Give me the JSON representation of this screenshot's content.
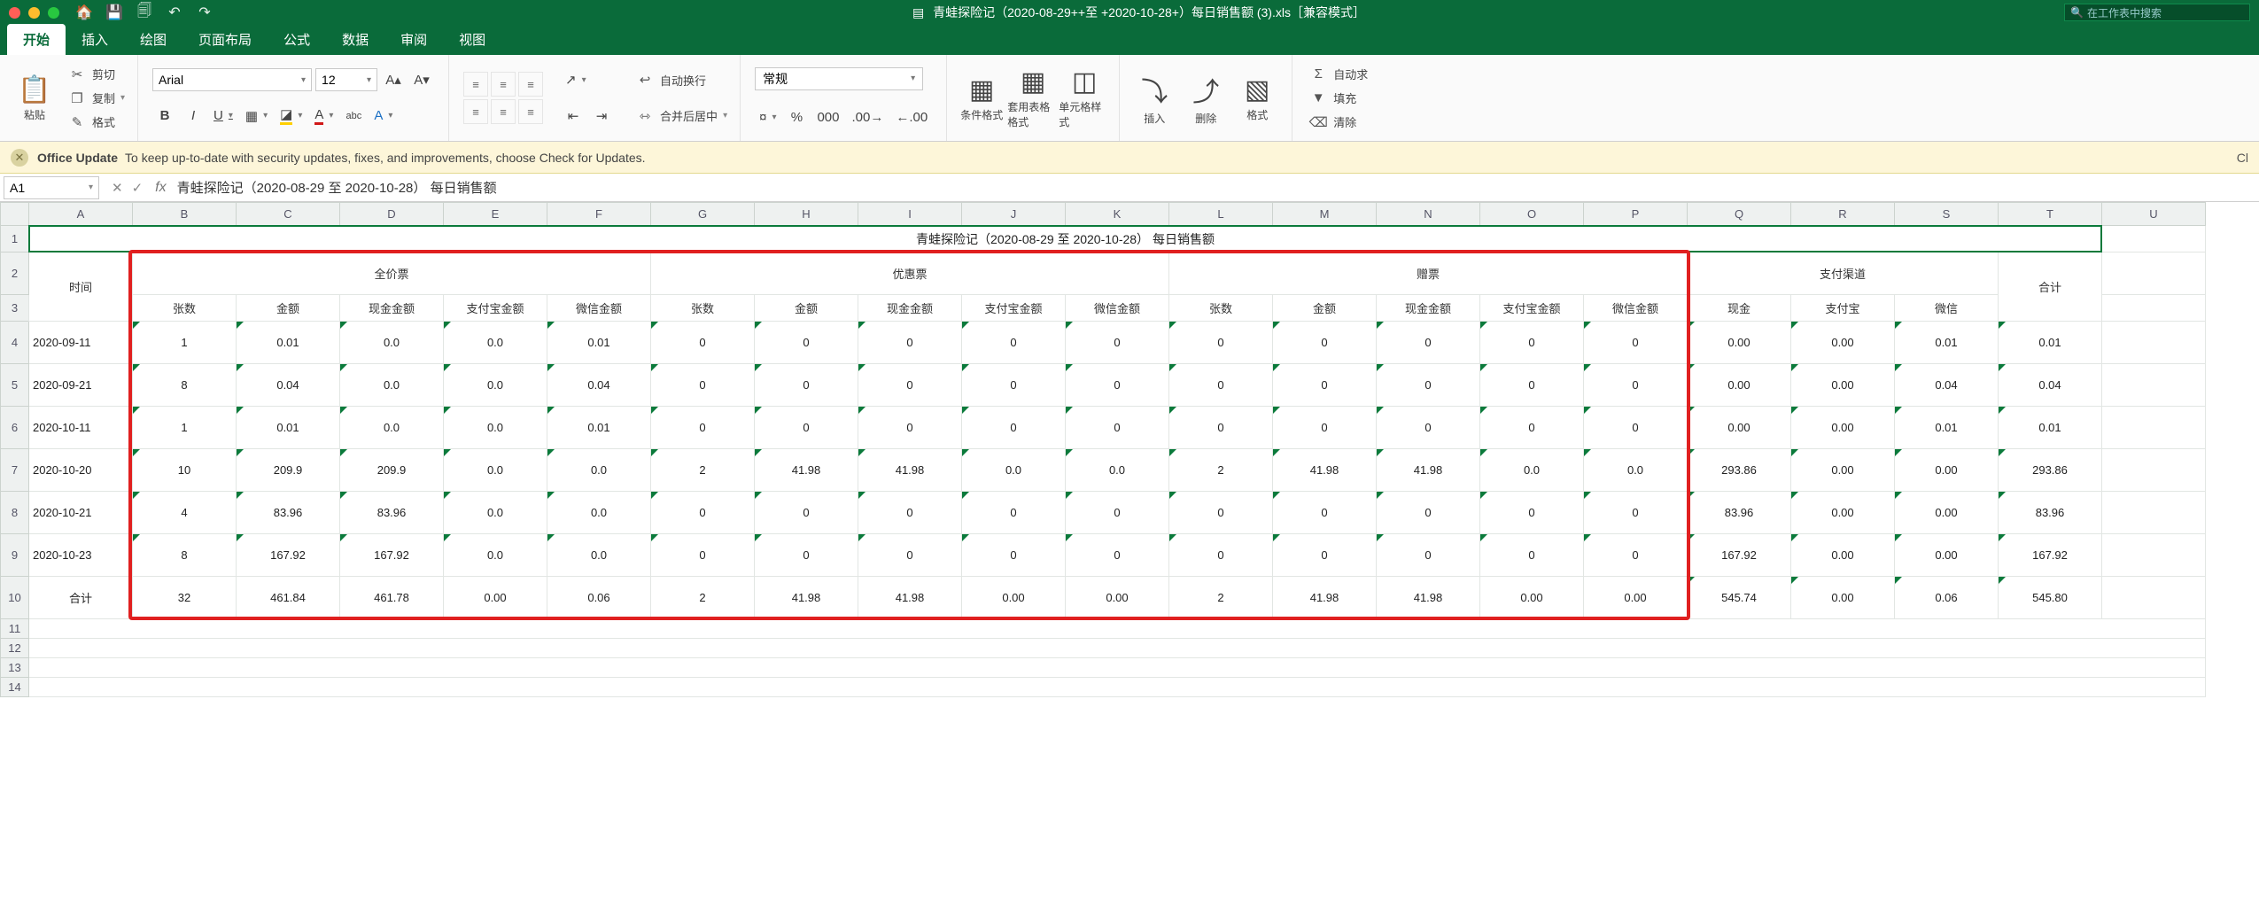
{
  "app": {
    "title": "青蛙探险记（2020-08-29++至 +2020-10-28+）每日销售额 (3).xls［兼容模式］",
    "search_placeholder": "在工作表中搜索"
  },
  "tabs": [
    "开始",
    "插入",
    "绘图",
    "页面布局",
    "公式",
    "数据",
    "审阅",
    "视图"
  ],
  "tabs_active_index": 0,
  "ribbon": {
    "clipboard": {
      "paste": "粘贴",
      "cut": "剪切",
      "copy": "复制",
      "format": "格式"
    },
    "font_name": "Arial",
    "font_size": "12",
    "btn_bold": "B",
    "btn_italic": "I",
    "btn_under": "U",
    "wrap_text": "自动换行",
    "merge_center": "合并后居中",
    "number_format": "常规",
    "cond_format": "条件格式",
    "tbl_format": "套用表格格式",
    "cell_styles": "单元格样式",
    "insert": "插入",
    "delete": "删除",
    "fmt": "格式",
    "autosum": "自动求",
    "fill": "填充",
    "clear": "清除"
  },
  "banner": {
    "head": "Office Update",
    "body": "To keep up-to-date with security updates, fixes, and improvements, choose Check for Updates.",
    "close": "Cl"
  },
  "fx": {
    "name_box": "A1",
    "formula": "青蛙探险记（2020-08-29 至 2020-10-28） 每日销售额"
  },
  "columns": [
    "A",
    "B",
    "C",
    "D",
    "E",
    "F",
    "G",
    "H",
    "I",
    "J",
    "K",
    "L",
    "M",
    "N",
    "O",
    "P",
    "Q",
    "R",
    "S",
    "T",
    "U"
  ],
  "row_numbers": [
    "1",
    "2",
    "3",
    "4",
    "5",
    "6",
    "7",
    "8",
    "9",
    "10",
    "11",
    "12",
    "13",
    "14"
  ],
  "report_title": "青蛙探险记（2020-08-29 至 2020-10-28） 每日销售额",
  "header_groups": {
    "time": "时间",
    "full": "全价票",
    "disc": "优惠票",
    "gift": "赠票",
    "pay": "支付渠道",
    "total": "合计"
  },
  "sub_headers": {
    "qty": "张数",
    "amt": "金额",
    "cash": "现金金额",
    "ali": "支付宝金额",
    "wx": "微信金额",
    "pay_cash": "现金",
    "pay_ali": "支付宝",
    "pay_wx": "微信"
  },
  "rows": [
    {
      "date": "2020-09-11",
      "f_qty": "1",
      "f_amt": "0.01",
      "f_cash": "0.0",
      "f_ali": "0.0",
      "f_wx": "0.01",
      "d_qty": "0",
      "d_amt": "0",
      "d_cash": "0",
      "d_ali": "0",
      "d_wx": "0",
      "g_qty": "0",
      "g_amt": "0",
      "g_cash": "0",
      "g_ali": "0",
      "g_wx": "0",
      "p_cash": "0.00",
      "p_ali": "0.00",
      "p_wx": "0.01",
      "tot": "0.01"
    },
    {
      "date": "2020-09-21",
      "f_qty": "8",
      "f_amt": "0.04",
      "f_cash": "0.0",
      "f_ali": "0.0",
      "f_wx": "0.04",
      "d_qty": "0",
      "d_amt": "0",
      "d_cash": "0",
      "d_ali": "0",
      "d_wx": "0",
      "g_qty": "0",
      "g_amt": "0",
      "g_cash": "0",
      "g_ali": "0",
      "g_wx": "0",
      "p_cash": "0.00",
      "p_ali": "0.00",
      "p_wx": "0.04",
      "tot": "0.04"
    },
    {
      "date": "2020-10-11",
      "f_qty": "1",
      "f_amt": "0.01",
      "f_cash": "0.0",
      "f_ali": "0.0",
      "f_wx": "0.01",
      "d_qty": "0",
      "d_amt": "0",
      "d_cash": "0",
      "d_ali": "0",
      "d_wx": "0",
      "g_qty": "0",
      "g_amt": "0",
      "g_cash": "0",
      "g_ali": "0",
      "g_wx": "0",
      "p_cash": "0.00",
      "p_ali": "0.00",
      "p_wx": "0.01",
      "tot": "0.01"
    },
    {
      "date": "2020-10-20",
      "f_qty": "10",
      "f_amt": "209.9",
      "f_cash": "209.9",
      "f_ali": "0.0",
      "f_wx": "0.0",
      "d_qty": "2",
      "d_amt": "41.98",
      "d_cash": "41.98",
      "d_ali": "0.0",
      "d_wx": "0.0",
      "g_qty": "2",
      "g_amt": "41.98",
      "g_cash": "41.98",
      "g_ali": "0.0",
      "g_wx": "0.0",
      "p_cash": "293.86",
      "p_ali": "0.00",
      "p_wx": "0.00",
      "tot": "293.86"
    },
    {
      "date": "2020-10-21",
      "f_qty": "4",
      "f_amt": "83.96",
      "f_cash": "83.96",
      "f_ali": "0.0",
      "f_wx": "0.0",
      "d_qty": "0",
      "d_amt": "0",
      "d_cash": "0",
      "d_ali": "0",
      "d_wx": "0",
      "g_qty": "0",
      "g_amt": "0",
      "g_cash": "0",
      "g_ali": "0",
      "g_wx": "0",
      "p_cash": "83.96",
      "p_ali": "0.00",
      "p_wx": "0.00",
      "tot": "83.96"
    },
    {
      "date": "2020-10-23",
      "f_qty": "8",
      "f_amt": "167.92",
      "f_cash": "167.92",
      "f_ali": "0.0",
      "f_wx": "0.0",
      "d_qty": "0",
      "d_amt": "0",
      "d_cash": "0",
      "d_ali": "0",
      "d_wx": "0",
      "g_qty": "0",
      "g_amt": "0",
      "g_cash": "0",
      "g_ali": "0",
      "g_wx": "0",
      "p_cash": "167.92",
      "p_ali": "0.00",
      "p_wx": "0.00",
      "tot": "167.92"
    }
  ],
  "totals": {
    "label": "合计",
    "f_qty": "32",
    "f_amt": "461.84",
    "f_cash": "461.78",
    "f_ali": "0.00",
    "f_wx": "0.06",
    "d_qty": "2",
    "d_amt": "41.98",
    "d_cash": "41.98",
    "d_ali": "0.00",
    "d_wx": "0.00",
    "g_qty": "2",
    "g_amt": "41.98",
    "g_cash": "41.98",
    "g_ali": "0.00",
    "g_wx": "0.00",
    "p_cash": "545.74",
    "p_ali": "0.00",
    "p_wx": "0.06",
    "tot": "545.80"
  },
  "chart_data": {
    "type": "table",
    "title": "青蛙探险记（2020-08-29 至 2020-10-28） 每日销售额",
    "columns": [
      "时间",
      "全价票-张数",
      "全价票-金额",
      "全价票-现金金额",
      "全价票-支付宝金额",
      "全价票-微信金额",
      "优惠票-张数",
      "优惠票-金额",
      "优惠票-现金金额",
      "优惠票-支付宝金额",
      "优惠票-微信金额",
      "赠票-张数",
      "赠票-金额",
      "赠票-现金金额",
      "赠票-支付宝金额",
      "赠票-微信金额",
      "现金",
      "支付宝",
      "微信",
      "合计"
    ],
    "rows": [
      [
        "2020-09-11",
        1,
        0.01,
        0.0,
        0.0,
        0.01,
        0,
        0,
        0,
        0,
        0,
        0,
        0,
        0,
        0,
        0,
        0.0,
        0.0,
        0.01,
        0.01
      ],
      [
        "2020-09-21",
        8,
        0.04,
        0.0,
        0.0,
        0.04,
        0,
        0,
        0,
        0,
        0,
        0,
        0,
        0,
        0,
        0,
        0.0,
        0.0,
        0.04,
        0.04
      ],
      [
        "2020-10-11",
        1,
        0.01,
        0.0,
        0.0,
        0.01,
        0,
        0,
        0,
        0,
        0,
        0,
        0,
        0,
        0,
        0,
        0.0,
        0.0,
        0.01,
        0.01
      ],
      [
        "2020-10-20",
        10,
        209.9,
        209.9,
        0.0,
        0.0,
        2,
        41.98,
        41.98,
        0.0,
        0.0,
        2,
        41.98,
        41.98,
        0.0,
        0.0,
        293.86,
        0.0,
        0.0,
        293.86
      ],
      [
        "2020-10-21",
        4,
        83.96,
        83.96,
        0.0,
        0.0,
        0,
        0,
        0,
        0,
        0,
        0,
        0,
        0,
        0,
        0,
        83.96,
        0.0,
        0.0,
        83.96
      ],
      [
        "2020-10-23",
        8,
        167.92,
        167.92,
        0.0,
        0.0,
        0,
        0,
        0,
        0,
        0,
        0,
        0,
        0,
        0,
        0,
        167.92,
        0.0,
        0.0,
        167.92
      ],
      [
        "合计",
        32,
        461.84,
        461.78,
        0.0,
        0.06,
        2,
        41.98,
        41.98,
        0.0,
        0.0,
        2,
        41.98,
        41.98,
        0.0,
        0.0,
        545.74,
        0.0,
        0.06,
        545.8
      ]
    ]
  }
}
